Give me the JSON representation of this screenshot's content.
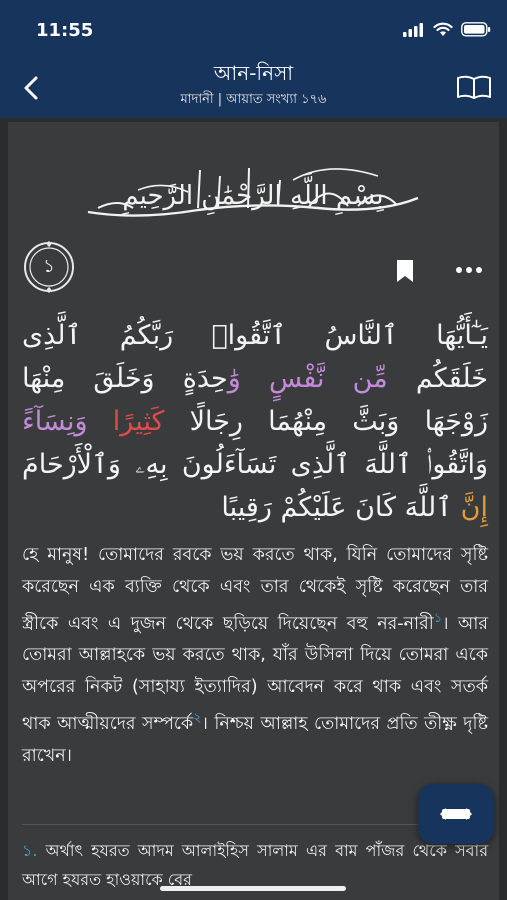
{
  "status_bar": {
    "time": "11:55"
  },
  "header": {
    "title": "আন-নিসা",
    "subtitle": "মাদানী | আয়াত সংখ্যা ১৭৬"
  },
  "bismillah": "بِسْمِ اللَّهِ الرَّحْمَٰنِ الرَّحِيمِ",
  "ayah": {
    "number": "১",
    "arabic_lines": [
      [
        "يَـٰٓأَيُّهَا ٱلنَّاسُ ٱتَّقُوا۟ رَبَّكُمُ ٱلَّذِى"
      ],
      [
        "خَلَقَكُم",
        "مِّن نَّفْسٍ",
        "وَ",
        "ٰحِدَةٍ",
        "وَخَلَقَ مِنْهَا"
      ],
      [
        "زَوْجَهَا وَبَثَّ مِنْهُمَا رِجَالًا",
        "كَثِيرًا",
        "وَنِسَآءً"
      ],
      [
        "وَاتَّقُوا۟ ٱللَّهَ ٱلَّذِى تَسَآءَلُونَ بِهِۦ وَٱلْأَرْحَامَ"
      ],
      [
        "إِنَّ",
        "ٱللَّهَ كَانَ عَلَيْكُمْ رَقِيبًا"
      ]
    ],
    "translation_parts": [
      "হে মানুষ! তোমাদের রবকে ভয় করতে থাক, যিনি তোমাদের সৃষ্টি করেছেন এক ব্যক্তি থেকে এবং তার থেকেই সৃষ্টি করেছেন তার স্ত্রীকে এবং এ দুজন থেকে ছড়িয়ে দিয়েছেন বহু নর-নারী",
      "১",
      "। আর তোমরা আল্লাহকে ভয় করতে থাক, যাঁর উসিলা দিয়ে তোমরা একে অপরের নিকট (সাহায্য ইত্যাদির) আবেদন করে থাক এবং সতর্ক থাক আত্মীয়দের সম্পর্কে",
      "২",
      "। নিশ্চয় আল্লাহ তোমাদের প্রতি তীক্ষ্ণ দৃষ্টি রাখেন।"
    ],
    "footnote_number": "১.",
    "footnote_text": " অর্থাৎ হযরত আদম আলাইহিস সালাম এর বাম পাঁজর থেকে সবার আগে হযরত হাওয়াকে বের"
  },
  "icons": {
    "back": "chevron-left-icon",
    "book": "open-book-icon",
    "bookmark": "bookmark-icon",
    "more": "more-horizontal-icon",
    "fab": "tafsir-icon"
  },
  "colors": {
    "header_bg": "#17355c",
    "content_bg": "#3a3b3d",
    "accent_blue": "#4aa3df",
    "tajweed_purple": "#c38ad9",
    "tajweed_red": "#e04a4a",
    "tajweed_orange": "#e09a3a"
  }
}
